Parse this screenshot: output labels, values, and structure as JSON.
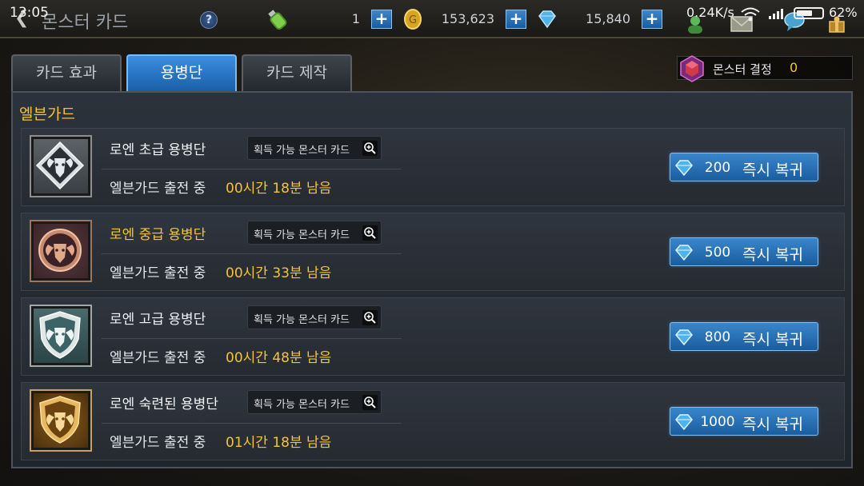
{
  "status_bar": {
    "time": "13:05",
    "network_speed": "0.24K/s",
    "battery_percent": "62%",
    "battery_level": 0.62
  },
  "header": {
    "title": "몬스터 카드",
    "resources": [
      {
        "icon": "potion-icon",
        "value": "1"
      },
      {
        "icon": "gold-coin-icon",
        "value": "153,623"
      },
      {
        "icon": "diamond-icon",
        "value": "15,840"
      }
    ],
    "plus_label": "+"
  },
  "tabs": [
    {
      "label": "카드 효과",
      "active": false
    },
    {
      "label": "용병단",
      "active": true
    },
    {
      "label": "카드 제작",
      "active": false
    }
  ],
  "crystal": {
    "label": "몬스터 결정",
    "value": "0"
  },
  "section": {
    "title": "엘븐가드"
  },
  "mercenaries": [
    {
      "name": "로엔 초급 용병단",
      "card_label": "획득 가능 몬스터 카드",
      "state": "엘븐가드 출전 중",
      "remaining": "00시간 18분 남음",
      "cost": "200",
      "recover_label": "즉시 복귀",
      "emblem": "silver-ram-icon"
    },
    {
      "name": "로엔 중급 용병단",
      "card_label": "획득 가능 몬스터 카드",
      "state": "엘븐가드 출전 중",
      "remaining": "00시간 33분 남음",
      "cost": "500",
      "recover_label": "즉시 복귀",
      "emblem": "bronze-ram-icon"
    },
    {
      "name": "로엔 고급 용병단",
      "card_label": "획득 가능 몬스터 카드",
      "state": "엘븐가드 출전 중",
      "remaining": "00시간 48분 남음",
      "cost": "800",
      "recover_label": "즉시 복귀",
      "emblem": "teal-ram-shield-icon"
    },
    {
      "name": "로엔 숙련된 용병단",
      "card_label": "획득 가능 몬스터 카드",
      "state": "엘븐가드 출전 중",
      "remaining": "01시간 18분 남음",
      "cost": "1000",
      "recover_label": "즉시 복귀",
      "emblem": "gold-ram-shield-icon"
    }
  ],
  "colors": {
    "accent_gold": "#f5c431",
    "button_blue": "#2a75bd"
  }
}
